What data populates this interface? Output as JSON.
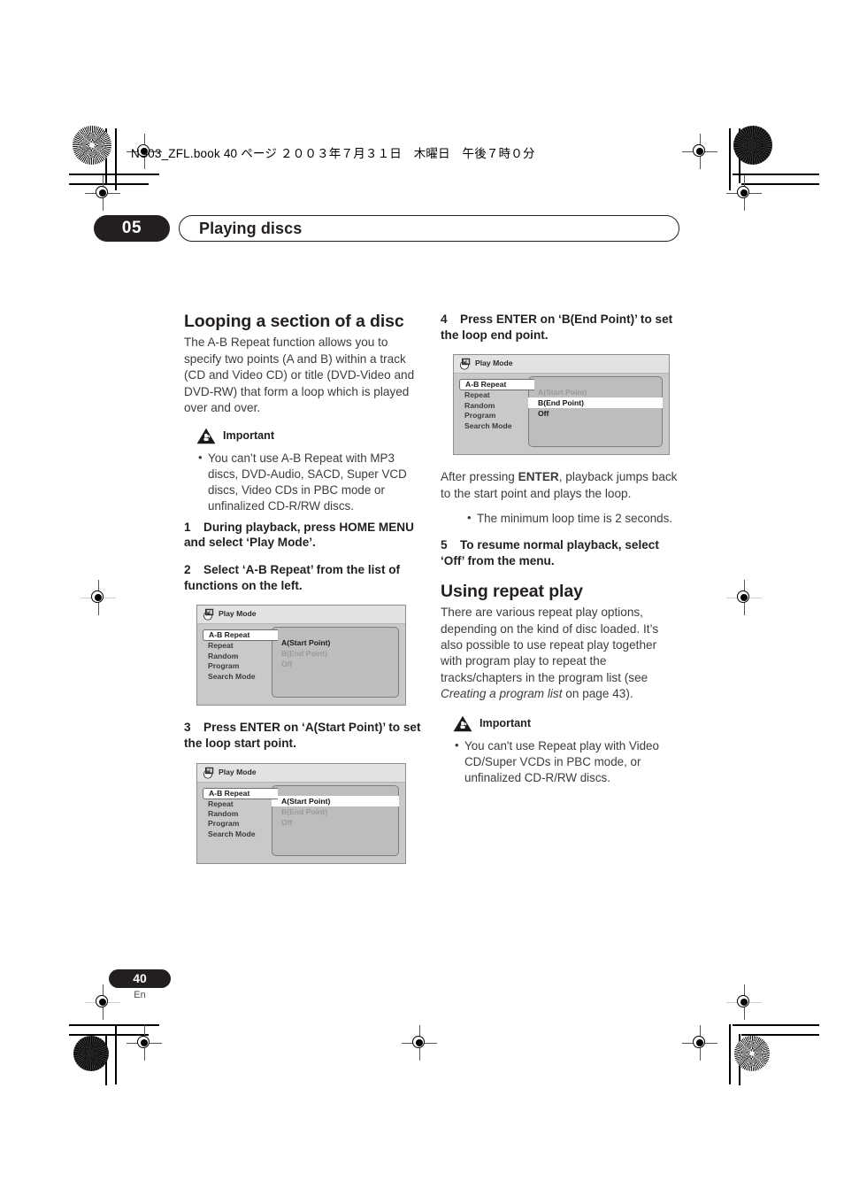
{
  "print_marks": {
    "file_banner": "NS03_ZFL.book  40 ページ  ２００３年７月３１日　木曜日　午後７時０分"
  },
  "header": {
    "chapter_number": "05",
    "chapter_title": "Playing discs"
  },
  "left_column": {
    "section_title": "Looping a section of a disc",
    "intro": "The A-B Repeat function allows you to specify two points (A and B) within a track (CD and Video CD) or title (DVD-Video and DVD-RW) that form a loop which is played over and over.",
    "important": {
      "label": "Important",
      "icon": "warning-triangle-icon",
      "bullets": [
        "You can’t use A-B Repeat with MP3 discs, DVD-Audio, SACD, Super VCD discs, Video CDs in PBC mode or unfinalized CD-R/RW discs."
      ]
    },
    "step1": {
      "number": "1",
      "text": "During playback, press HOME MENU and select ‘Play Mode’."
    },
    "step2": {
      "number": "2",
      "text": "Select ‘A-B Repeat’ from the list of functions on the left."
    },
    "step3": {
      "number": "3",
      "text": "Press ENTER on ‘A(Start Point)’ to set the loop start point."
    }
  },
  "right_column": {
    "step4": {
      "number": "4",
      "text": "Press ENTER on ‘B(End Point)’ to set the loop end point."
    },
    "after_enter_pre": "After pressing ",
    "after_enter_bold": "ENTER",
    "after_enter_post": ", playback jumps back to the start point and plays the loop.",
    "loop_bullet": "The minimum loop time is 2 seconds.",
    "step5": {
      "number": "5",
      "text": "To resume normal playback, select ‘Off’ from the menu."
    },
    "repeat_section_title": "Using repeat play",
    "repeat_intro_pre": "There are various repeat play options, depending on the kind of disc loaded. It’s also possible to use repeat play together with program play to repeat the tracks/chapters in the program list (see ",
    "repeat_intro_italic": "Creating a program list",
    "repeat_intro_post": " on page 43).",
    "important": {
      "label": "Important",
      "icon": "warning-triangle-icon",
      "bullets": [
        "You can't use Repeat play with Video CD/Super VCDs in PBC mode, or unfinalized CD-R/RW discs."
      ]
    }
  },
  "osd_screens": [
    {
      "id": "osd-step2",
      "title": "Play Mode",
      "icon": "play-mode-icon",
      "menu_items": [
        "A-B Repeat",
        "Repeat",
        "Random",
        "Program",
        "Search Mode"
      ],
      "selected_menu_item": "A-B Repeat",
      "options": [
        {
          "label": "A(Start Point)",
          "state": "normal"
        },
        {
          "label": "B(End Point)",
          "state": "dimmed"
        },
        {
          "label": "Off",
          "state": "dimmed"
        }
      ]
    },
    {
      "id": "osd-step3",
      "title": "Play Mode",
      "icon": "play-mode-icon",
      "menu_items": [
        "A-B Repeat",
        "Repeat",
        "Random",
        "Program",
        "Search Mode"
      ],
      "selected_menu_item": "A-B Repeat",
      "options": [
        {
          "label": "A(Start Point)",
          "state": "highlighted"
        },
        {
          "label": "B(End Point)",
          "state": "dimmed"
        },
        {
          "label": "Off",
          "state": "dimmed"
        }
      ]
    },
    {
      "id": "osd-step4",
      "title": "Play Mode",
      "icon": "play-mode-icon",
      "menu_items": [
        "A-B Repeat",
        "Repeat",
        "Random",
        "Program",
        "Search Mode"
      ],
      "selected_menu_item": "A-B Repeat",
      "options": [
        {
          "label": "A(Start Point)",
          "state": "dimmed"
        },
        {
          "label": "B(End Point)",
          "state": "highlighted"
        },
        {
          "label": "Off",
          "state": "normal"
        }
      ]
    }
  ],
  "footer": {
    "page_number": "40",
    "language_code": "En"
  },
  "colors": {
    "ink": "#231f20",
    "body_text": "#3c3c3c",
    "osd_background": "#c9c9c9",
    "osd_panel": "#bdbdbd",
    "osd_titlebar": "#e2e2e2"
  }
}
